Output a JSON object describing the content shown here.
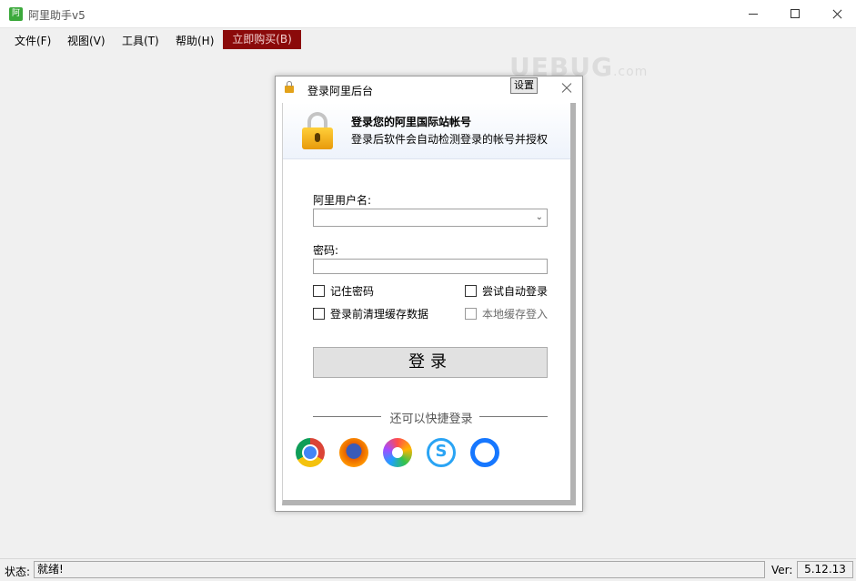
{
  "window": {
    "title": "阿里助手v5",
    "icon": "app-logo-icon"
  },
  "menu": {
    "items": [
      "文件(F)",
      "视图(V)",
      "工具(T)",
      "帮助(H)"
    ],
    "buy_label": "立即购买(B)",
    "buy_color": "#8b0a0a"
  },
  "watermark": {
    "text": "UEBUG",
    "suffix": ".com"
  },
  "dialog": {
    "title": "登录阿里后台",
    "settings_label": "设置",
    "header": {
      "title": "登录您的阿里国际站帐号",
      "subtitle": "登录后软件会自动检测登录的帐号并授权"
    },
    "username_label": "阿里用户名:",
    "username_value": "",
    "password_label": "密码:",
    "password_value": "",
    "checkboxes": {
      "remember": "记住密码",
      "auto_login": "尝试自动登录",
      "clear_cache": "登录前清理缓存数据",
      "local_cache": "本地缓存登入"
    },
    "login_button": "登录",
    "quick_login_text": "还可以快捷登录",
    "browsers": [
      "chrome-icon",
      "firefox-icon",
      "360-browser-icon",
      "sogou-browser-icon",
      "qq-browser-icon"
    ]
  },
  "status": {
    "label": "状态:",
    "value": "就绪!",
    "ver_label": "Ver:",
    "ver_value": "5.12.13"
  }
}
